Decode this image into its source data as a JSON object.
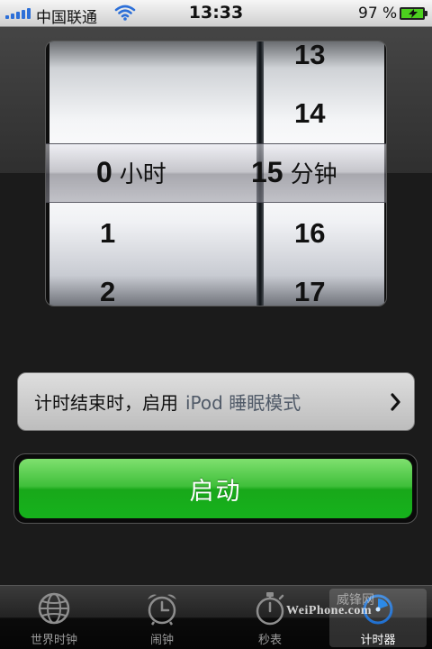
{
  "status_bar": {
    "carrier": "中国联通",
    "time": "13:33",
    "battery_percent": "97 %",
    "battery_level": 0.97,
    "signal_bars": 5
  },
  "picker": {
    "hours": {
      "above": [],
      "selected": "0",
      "unit": "小时",
      "below": [
        "1",
        "2"
      ]
    },
    "minutes": {
      "above": [
        "13",
        "14"
      ],
      "selected": "15",
      "unit": "分钟",
      "below": [
        "16",
        "17"
      ]
    }
  },
  "sound_row": {
    "label": "计时结束时，启用",
    "value": "iPod 睡眠模式"
  },
  "start_button": {
    "label": "启动",
    "color": "#1fb224"
  },
  "tabs": [
    {
      "label": "世界时钟",
      "icon": "globe-icon",
      "active": false
    },
    {
      "label": "闹钟",
      "icon": "alarm-clock-icon",
      "active": false
    },
    {
      "label": "秒表",
      "icon": "stopwatch-icon",
      "active": false
    },
    {
      "label": "计时器",
      "icon": "timer-icon",
      "active": true
    }
  ],
  "watermark": {
    "chinese": "威锋网",
    "english": "WeiPhone.com"
  },
  "colors": {
    "accent_green": "#1fb224",
    "active_tab_icon": "#2c8ae8"
  }
}
